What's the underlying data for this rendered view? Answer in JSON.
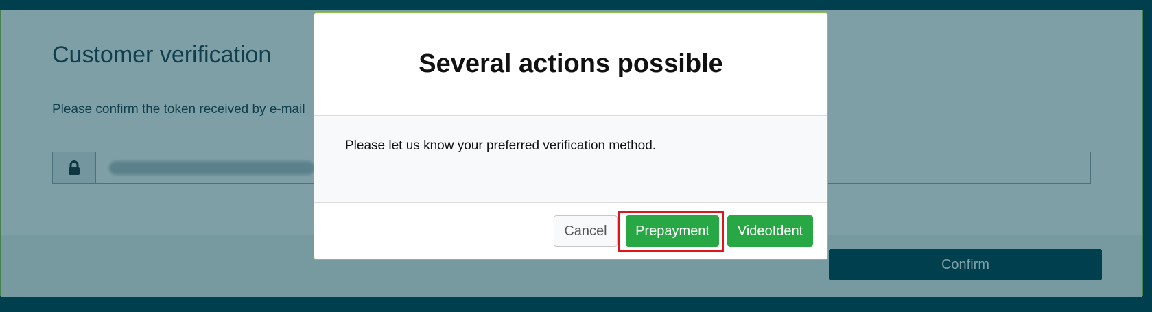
{
  "page": {
    "title": "Customer verification",
    "description": "Please confirm the token received by e-mail",
    "token_input": {
      "value": "",
      "icon": "lock-icon"
    },
    "confirm_label": "Confirm"
  },
  "modal": {
    "title": "Several actions possible",
    "message": "Please let us know your preferred verification method.",
    "buttons": {
      "cancel": "Cancel",
      "prepayment": "Prepayment",
      "videoident": "VideoIdent"
    }
  },
  "colors": {
    "brand_dark": "#003f4d",
    "accent_green": "#28a745",
    "border_green": "#8bc34a",
    "highlight_red": "#e0141b"
  }
}
